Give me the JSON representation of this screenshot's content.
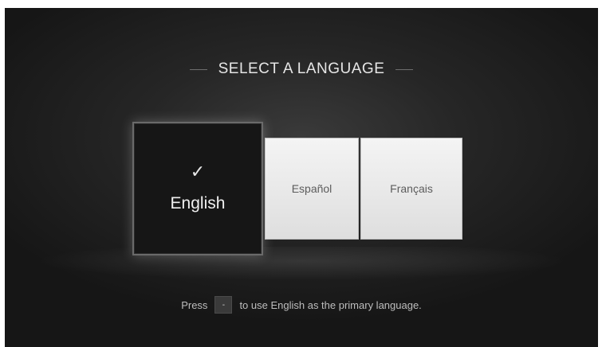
{
  "title": "SELECT A LANGUAGE",
  "languages": [
    {
      "label": "English",
      "selected": true,
      "check_glyph": "✓"
    },
    {
      "label": "Español",
      "selected": false
    },
    {
      "label": "Français",
      "selected": false
    }
  ],
  "hint": {
    "before": "Press",
    "key_glyph": "-",
    "after": "to use English as the primary language."
  },
  "icons": {
    "selected_indicator": "checkmark-icon",
    "key": "minus-key-icon"
  }
}
